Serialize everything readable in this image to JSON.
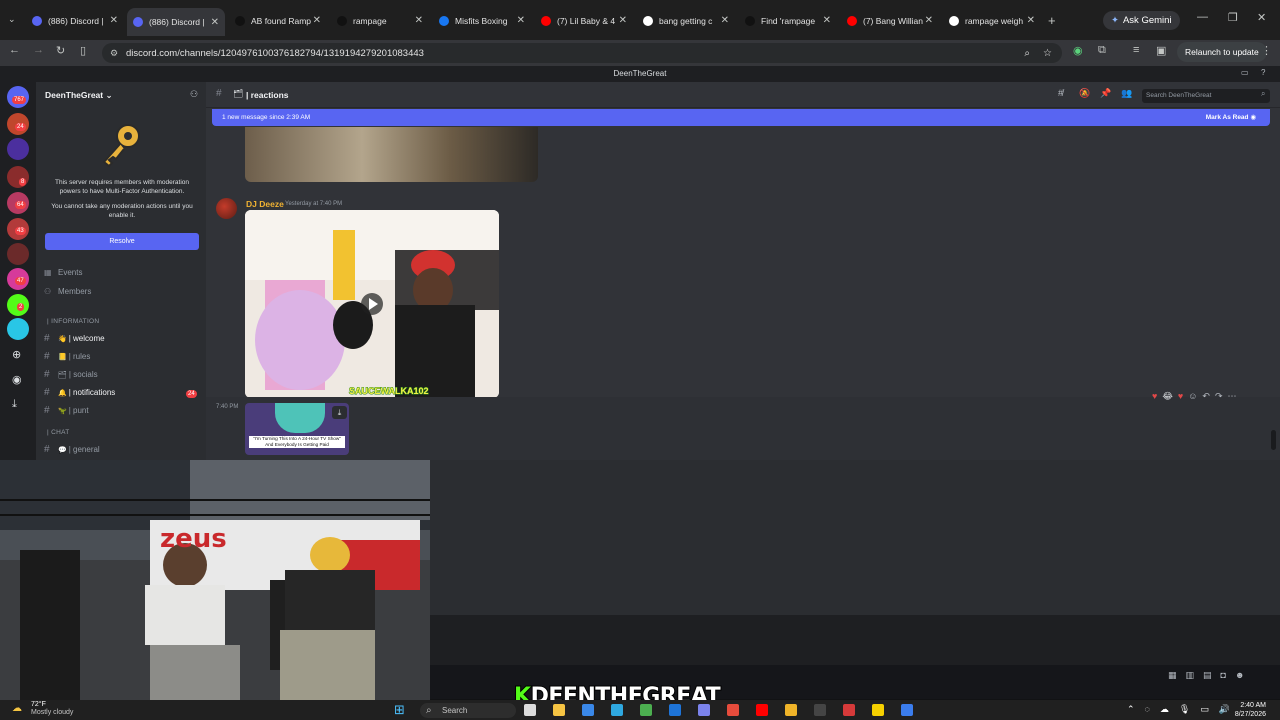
{
  "browser": {
    "tabs": [
      {
        "title": "(886) Discord |",
        "icon": "discord-icon",
        "color": "#5865f2",
        "active": false
      },
      {
        "title": "(886) Discord |",
        "icon": "discord-icon",
        "color": "#5865f2",
        "active": true
      },
      {
        "title": "AB found Ramp",
        "icon": "tiktok-icon",
        "color": "#111111",
        "active": false
      },
      {
        "title": "rampage",
        "icon": "tiktok-icon",
        "color": "#111111",
        "active": false
      },
      {
        "title": "Misfits Boxing",
        "icon": "facebook-icon",
        "color": "#1877f2",
        "active": false
      },
      {
        "title": "(7) Lil Baby & 4",
        "icon": "youtube-icon",
        "color": "#ff0000",
        "active": false
      },
      {
        "title": "bang getting c",
        "icon": "google-icon",
        "color": "#ffffff",
        "active": false
      },
      {
        "title": "Find 'rampage",
        "icon": "tiktok-icon",
        "color": "#111111",
        "active": false
      },
      {
        "title": "(7) Bang Willian",
        "icon": "youtube-icon",
        "color": "#ff0000",
        "active": false
      },
      {
        "title": "rampage weigh",
        "icon": "google-icon",
        "color": "#ffffff",
        "active": false
      }
    ],
    "new_tab": "+",
    "gemini": "Ask Gemini",
    "url": "discord.com/channels/1204976100376182794/1319194279201083443",
    "relaunch": "Relaunch to update"
  },
  "discord": {
    "window_title": "DeenTheGreat",
    "rail_badges": [
      "767",
      "24",
      "8",
      "64",
      "43",
      "47",
      "2"
    ],
    "server_name": "DeenTheGreat",
    "mfa_line1": "This server requires members with moderation powers to have Multi-Factor Authentication.",
    "mfa_line2": "You cannot take any moderation actions until you enable it.",
    "resolve": "Resolve",
    "nav": [
      {
        "label": "Events",
        "icon": "calendar-icon"
      },
      {
        "label": "Members",
        "icon": "members-icon"
      }
    ],
    "cat_information": "| INFORMATION",
    "channels": [
      {
        "label": "| welcome",
        "emoji": "👋",
        "bright": true
      },
      {
        "label": "| rules",
        "emoji": "📒",
        "bright": false
      },
      {
        "label": "| socials",
        "emoji": "🗂",
        "bright": false
      },
      {
        "label": "| notifications",
        "emoji": "🔔",
        "bright": true,
        "badge": "24"
      },
      {
        "label": "| punt",
        "emoji": "🦖",
        "bright": false
      }
    ],
    "cat_chat": "| CHAT",
    "chat_channels": [
      {
        "label": "| general",
        "emoji": "💬",
        "bright": false
      }
    ],
    "channel_name": "| reactions",
    "search_placeholder": "Search DeenTheGreat",
    "new_messages": "1 new message since 2:39 AM",
    "mark_read": "Mark As Read",
    "message": {
      "author": "DJ Deeze",
      "timestamp": "Yesterday at 7:40 PM",
      "video_watermark": "SAUCEWALKA102"
    },
    "second_time": "7:40 PM",
    "second_caption": "\"I'm Turning This Into A 24-Hour TV Show\" And Everybody Is Getting Paid"
  },
  "stream": {
    "overlay_name": "DEENTHEGREAT",
    "brand": "zeus"
  },
  "taskbar": {
    "weather_temp": "72°F",
    "weather_desc": "Mostly cloudy",
    "search": "Search",
    "time": "2:40 AM",
    "date": "8/27/2026"
  }
}
